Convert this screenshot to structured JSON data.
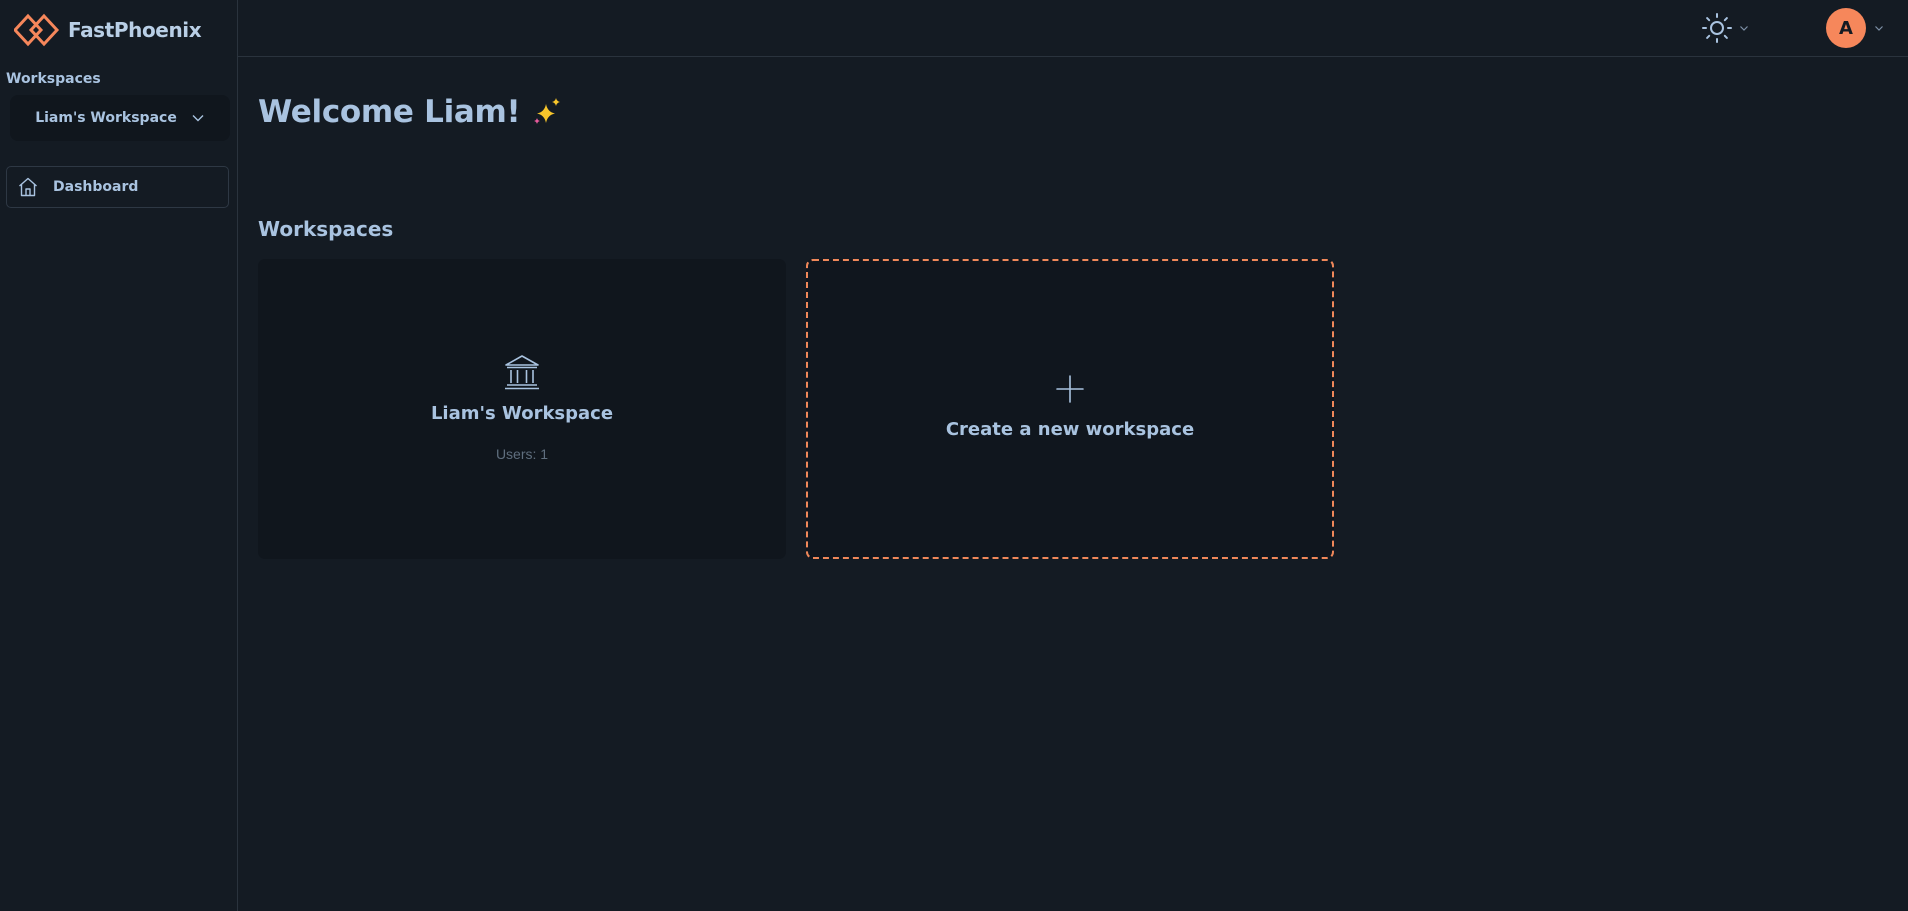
{
  "app": {
    "name": "FastPhoenix",
    "accent_color": "#f6875b"
  },
  "sidebar": {
    "workspaces_heading": "Workspaces",
    "workspace_selector": {
      "selected": "Liam's Workspace"
    },
    "nav": [
      {
        "label": "Dashboard",
        "icon": "home-icon"
      }
    ]
  },
  "topbar": {
    "theme_icon": "sun-icon",
    "avatar_initial": "A"
  },
  "main": {
    "welcome": "Welcome Liam!",
    "welcome_icon": "sparkles-icon",
    "section_title": "Workspaces",
    "workspaces": [
      {
        "name": "Liam's Workspace",
        "users": "Users: 1",
        "icon": "bank-icon"
      }
    ],
    "create_label": "Create a new workspace"
  }
}
